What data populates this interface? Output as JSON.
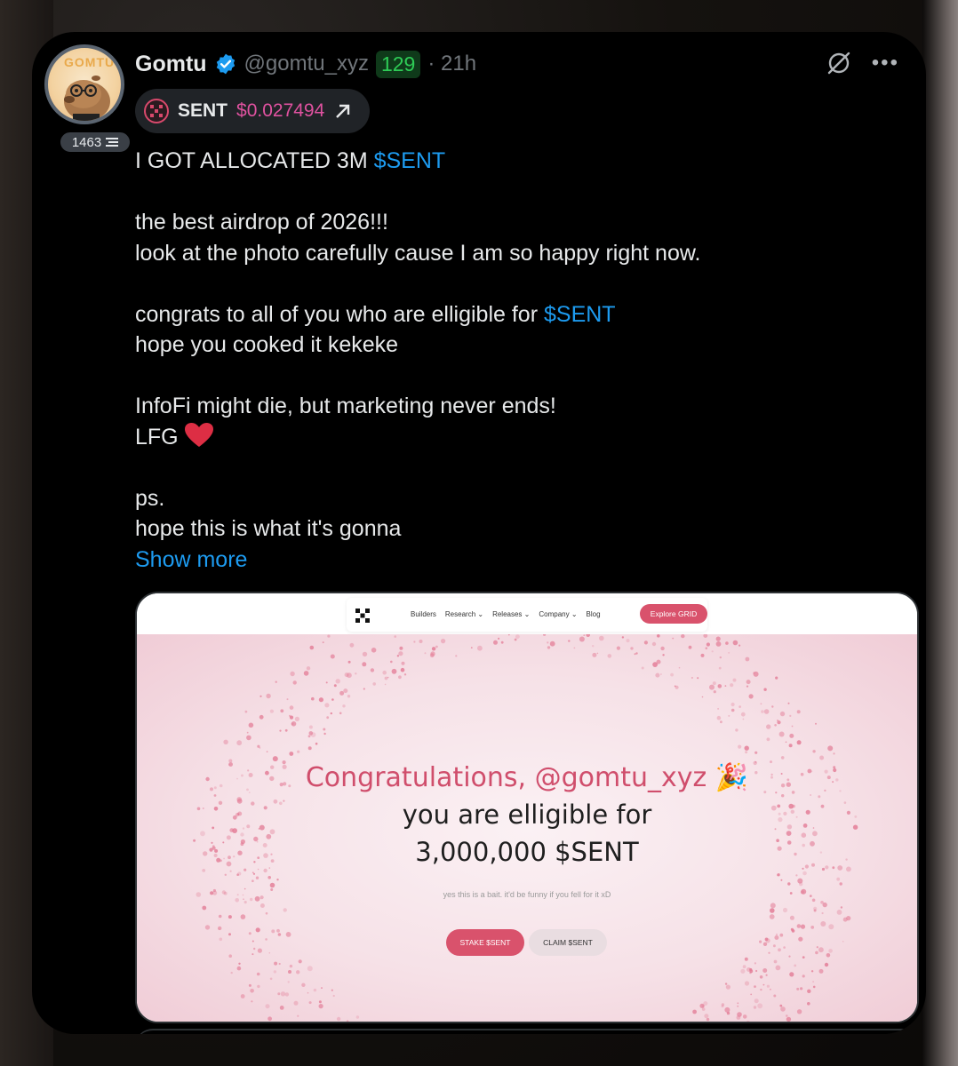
{
  "author": {
    "name": "Gomtu",
    "handle": "@gomtu_xyz",
    "score": "129",
    "time": "· 21h",
    "follower_badge": "1463",
    "avatar_text": "GOMTU"
  },
  "token": {
    "symbol": "SENT",
    "price": "$0.027494"
  },
  "tweet": {
    "line1_prefix": "I GOT ALLOCATED 3M ",
    "line1_cashtag": "$SENT",
    "line2": "the best airdrop of 2026!!!",
    "line3": "look at the photo carefully cause I am so happy right now.",
    "line4_prefix": "congrats to all of you who are elligible for ",
    "line4_cashtag": "$SENT",
    "line5": "hope you cooked it kekeke",
    "line6": "InfoFi might die, but marketing never ends!",
    "line7": "LFG",
    "line8": "ps.",
    "line9": "hope this is what it's gonna",
    "show_more": "Show more"
  },
  "media": {
    "nav_links": [
      "Builders",
      "Research ⌄",
      "Releases ⌄",
      "Company ⌄",
      "Blog"
    ],
    "explore_button": "Explore GRID",
    "congrats": "Congratulations, @gomtu_xyz 🎉",
    "line1": "you are elligible for",
    "line2": "3,000,000 $SENT",
    "subtext": "yes this is a bait. it'd be funny if you fell for it xD",
    "stake_button": "STAKE $SENT",
    "claim_button": "CLAIM $SENT"
  },
  "colors": {
    "accent_blue": "#1d9bf0",
    "price_pink": "#e052a0",
    "brand_pink": "#d9526c",
    "score_green": "#2ecc56"
  }
}
